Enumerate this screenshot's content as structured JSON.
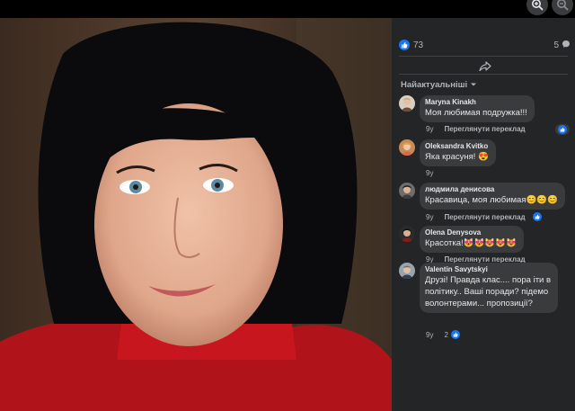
{
  "post": {
    "reaction_count": "73",
    "comment_count": "5",
    "sort_label": "Найактуальніші"
  },
  "comments": [
    {
      "author": "Maryna Kinakh",
      "text": "Моя любимая подружка!!!",
      "time": "9у",
      "translate": "Переглянути переклад",
      "reaction_count": ""
    },
    {
      "author": "Oleksandra Kvitko",
      "text": "Яка красуня! 😍",
      "time": "9у",
      "translate": "",
      "reaction_count": ""
    },
    {
      "author": "людмила денисова",
      "text": "Красавица, моя любимая😊😊😊",
      "time": "9у",
      "translate": "Переглянути переклад",
      "reaction_count": ""
    },
    {
      "author": "Olena Denysova",
      "text": "Красотка!😻😻😻😻😻",
      "time": "9у",
      "translate": "Переглянути переклад",
      "reaction_count": ""
    },
    {
      "author": "Valentin Savytskyi",
      "text_lines": [
        "Друзі! Правда клас.... пора іти в",
        "політику.. Ваші поради? підемо",
        "волонтерами... пропозиції?"
      ],
      "time": "9у",
      "translate": "",
      "reaction_count": "2"
    }
  ],
  "icons": {
    "zoom_in": "zoom-in-icon",
    "zoom_out": "zoom-out-icon",
    "like": "like-icon",
    "comment": "comment-icon",
    "share": "share-icon",
    "sort_chevron": "chevron-down-icon"
  },
  "colors": {
    "panel_bg": "#242526",
    "bubble_bg": "#3a3b3c",
    "accent": "#1877f2",
    "text_primary": "#e4e6eb",
    "text_secondary": "#b0b3b8"
  }
}
